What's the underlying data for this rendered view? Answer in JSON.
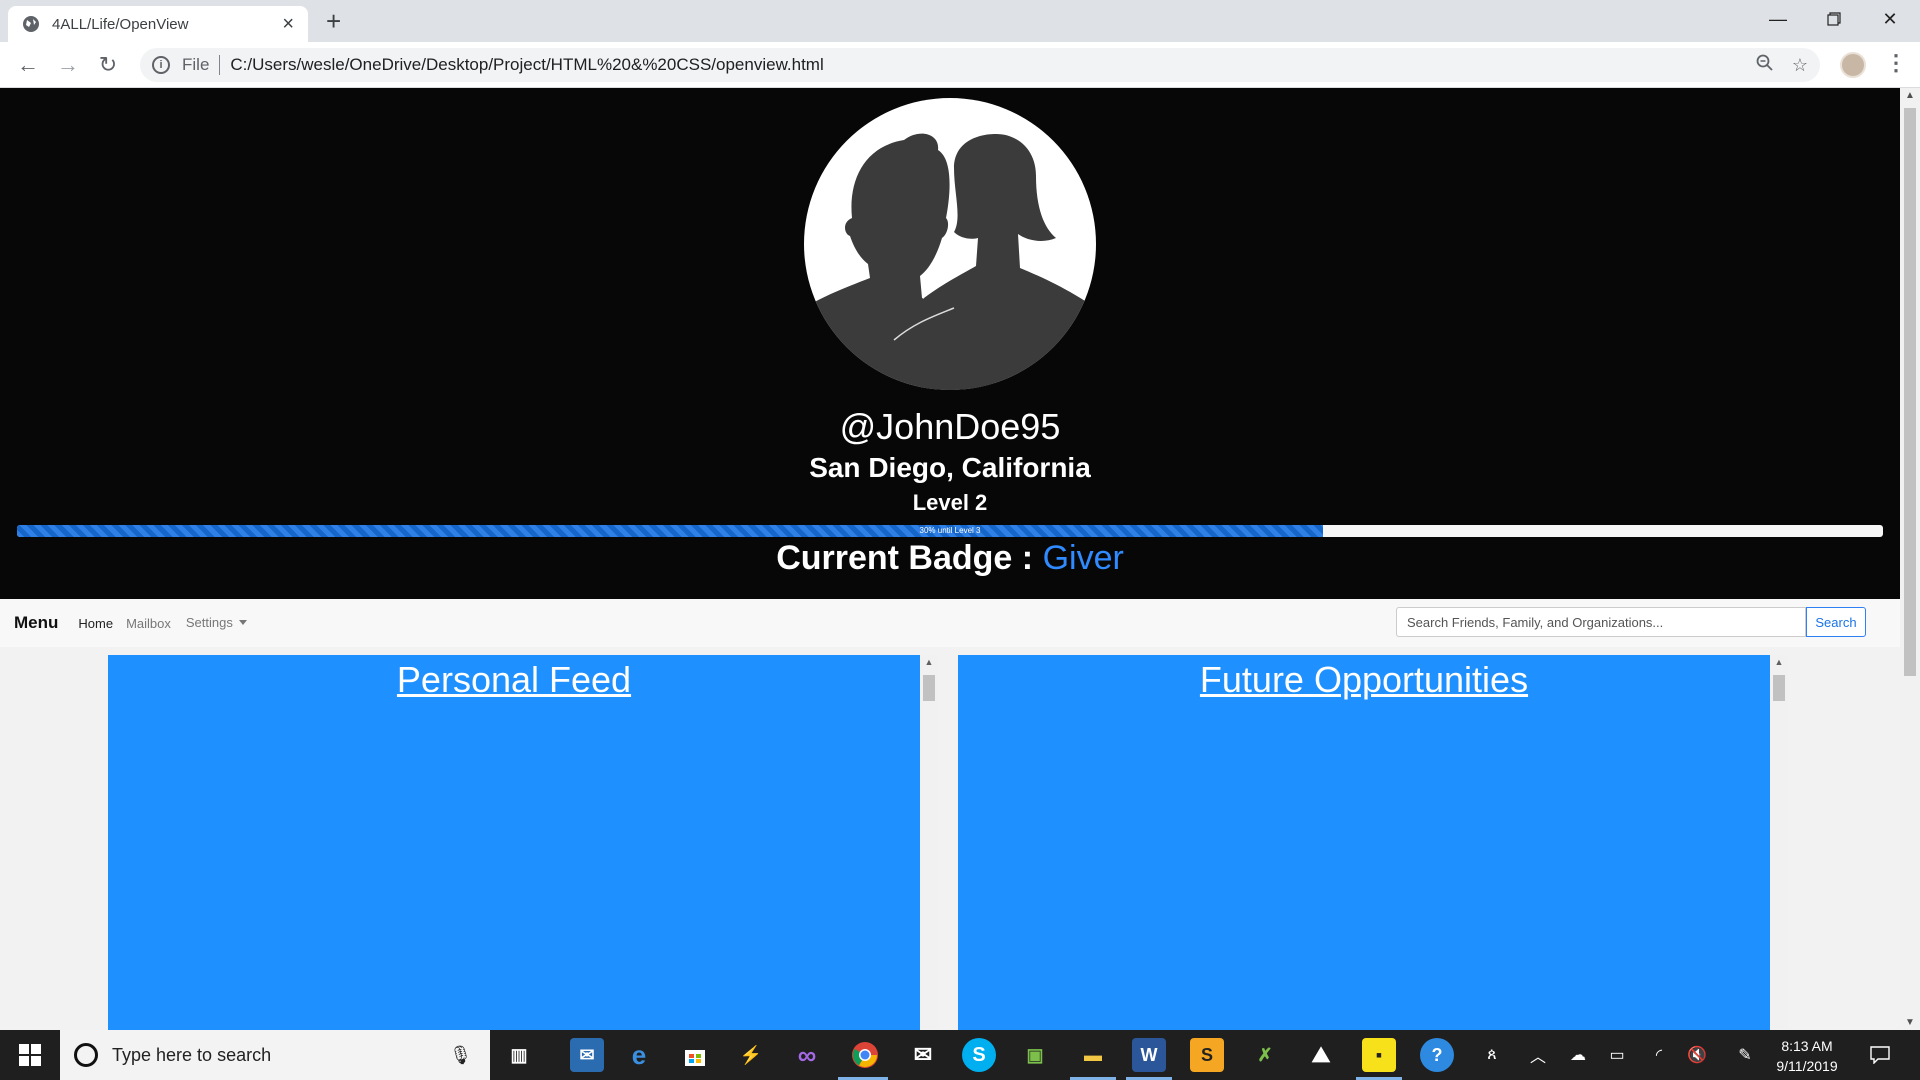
{
  "browser": {
    "tab_title": "4ALL/Life/OpenView",
    "new_tab_symbol": "+",
    "address_scheme": "File",
    "address_url": "C:/Users/wesle/OneDrive/Desktop/Project/HTML%20&%20CSS/openview.html",
    "icons": [
      "back-icon",
      "forward-icon",
      "reload-icon",
      "info-icon",
      "zoom-icon",
      "star-icon",
      "profile-avatar",
      "menu-icon"
    ]
  },
  "profile": {
    "username": "@JohnDoe95",
    "location": "San Diego, California",
    "level": "Level 2",
    "progress_text": "30% until Level 3",
    "progress_fraction": 0.7,
    "badge_label": "Current Badge :",
    "badge_name": "Giver"
  },
  "navbar": {
    "brand": "Menu",
    "links": [
      "Home",
      "Mailbox",
      "Settings"
    ],
    "search_placeholder": "Search Friends, Family, and Organizations...",
    "search_button": "Search"
  },
  "panels": {
    "left_title": "Personal Feed",
    "right_title": "Future Opportunities"
  },
  "taskbar": {
    "search_placeholder": "Type here to search",
    "time": "8:13 AM",
    "date": "9/11/2019"
  },
  "colors": {
    "hero_bg": "#070707",
    "accent_blue": "#1e90ff",
    "badge_blue": "#2f8bff",
    "progress_blue": "#2e7fe6"
  }
}
